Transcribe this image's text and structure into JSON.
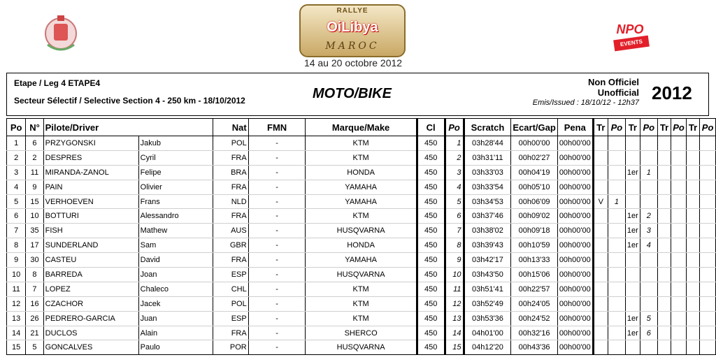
{
  "event": {
    "logo_top_text": "RALLYE",
    "logo_brand": "OiLibya",
    "logo_bottom_text": "MAROC",
    "dates": "14 au 20 octobre 2012",
    "organizer_logo": "NPO",
    "organizer_logo_sub": "EVENTS"
  },
  "header": {
    "etape": "Etape / Leg 4  ETAPE4",
    "secteur": "Secteur Sélectif / Selective Section 4 - 250 km - 18/10/2012",
    "category": "MOTO/BIKE",
    "status_fr": "Non Officiel",
    "status_en": "Unofficial",
    "emis": "Emis/Issued : 18/10/12 - 12h37",
    "year": "2012"
  },
  "columns": [
    "Po",
    "N°",
    "Pilote/Driver",
    "Nat",
    "FMN",
    "Marque/Make",
    "Cl",
    "Po",
    "Scratch",
    "Ecart/Gap",
    "Pena",
    "Tr",
    "Po",
    "Tr",
    "Po",
    "Tr",
    "Po",
    "Tr",
    "Po"
  ],
  "rows": [
    {
      "po": "1",
      "num": "6",
      "last": "PRZYGONSKI",
      "first": "Jakub",
      "nat": "POL",
      "fmn": "-",
      "make": "KTM",
      "cl": "450",
      "cpo": "1",
      "scratch": "03h28'44",
      "gap": "00h00'00",
      "pena": "00h00'00",
      "tr1": "",
      "po1": "",
      "tr2": "",
      "po2": "",
      "tr3": "",
      "po3": "",
      "tr4": "",
      "po4": ""
    },
    {
      "po": "2",
      "num": "2",
      "last": "DESPRES",
      "first": "Cyril",
      "nat": "FRA",
      "fmn": "-",
      "make": "KTM",
      "cl": "450",
      "cpo": "2",
      "scratch": "03h31'11",
      "gap": "00h02'27",
      "pena": "00h00'00",
      "tr1": "",
      "po1": "",
      "tr2": "",
      "po2": "",
      "tr3": "",
      "po3": "",
      "tr4": "",
      "po4": ""
    },
    {
      "po": "3",
      "num": "11",
      "last": "MIRANDA-ZANOL",
      "first": "Felipe",
      "nat": "BRA",
      "fmn": "-",
      "make": "HONDA",
      "cl": "450",
      "cpo": "3",
      "scratch": "03h33'03",
      "gap": "00h04'19",
      "pena": "00h00'00",
      "tr1": "",
      "po1": "",
      "tr2": "1er",
      "po2": "1",
      "tr3": "",
      "po3": "",
      "tr4": "",
      "po4": ""
    },
    {
      "po": "4",
      "num": "9",
      "last": "PAIN",
      "first": "Olivier",
      "nat": "FRA",
      "fmn": "-",
      "make": "YAMAHA",
      "cl": "450",
      "cpo": "4",
      "scratch": "03h33'54",
      "gap": "00h05'10",
      "pena": "00h00'00",
      "tr1": "",
      "po1": "",
      "tr2": "",
      "po2": "",
      "tr3": "",
      "po3": "",
      "tr4": "",
      "po4": ""
    },
    {
      "po": "5",
      "num": "15",
      "last": "VERHOEVEN",
      "first": "Frans",
      "nat": "NLD",
      "fmn": "-",
      "make": "YAMAHA",
      "cl": "450",
      "cpo": "5",
      "scratch": "03h34'53",
      "gap": "00h06'09",
      "pena": "00h00'00",
      "tr1": "V",
      "po1": "1",
      "tr2": "",
      "po2": "",
      "tr3": "",
      "po3": "",
      "tr4": "",
      "po4": ""
    },
    {
      "po": "6",
      "num": "10",
      "last": "BOTTURI",
      "first": "Alessandro",
      "nat": "FRA",
      "fmn": "-",
      "make": "KTM",
      "cl": "450",
      "cpo": "6",
      "scratch": "03h37'46",
      "gap": "00h09'02",
      "pena": "00h00'00",
      "tr1": "",
      "po1": "",
      "tr2": "1er",
      "po2": "2",
      "tr3": "",
      "po3": "",
      "tr4": "",
      "po4": ""
    },
    {
      "po": "7",
      "num": "35",
      "last": "FISH",
      "first": "Mathew",
      "nat": "AUS",
      "fmn": "-",
      "make": "HUSQVARNA",
      "cl": "450",
      "cpo": "7",
      "scratch": "03h38'02",
      "gap": "00h09'18",
      "pena": "00h00'00",
      "tr1": "",
      "po1": "",
      "tr2": "1er",
      "po2": "3",
      "tr3": "",
      "po3": "",
      "tr4": "",
      "po4": ""
    },
    {
      "po": "8",
      "num": "17",
      "last": "SUNDERLAND",
      "first": "Sam",
      "nat": "GBR",
      "fmn": "-",
      "make": "HONDA",
      "cl": "450",
      "cpo": "8",
      "scratch": "03h39'43",
      "gap": "00h10'59",
      "pena": "00h00'00",
      "tr1": "",
      "po1": "",
      "tr2": "1er",
      "po2": "4",
      "tr3": "",
      "po3": "",
      "tr4": "",
      "po4": ""
    },
    {
      "po": "9",
      "num": "30",
      "last": "CASTEU",
      "first": "David",
      "nat": "FRA",
      "fmn": "-",
      "make": "YAMAHA",
      "cl": "450",
      "cpo": "9",
      "scratch": "03h42'17",
      "gap": "00h13'33",
      "pena": "00h00'00",
      "tr1": "",
      "po1": "",
      "tr2": "",
      "po2": "",
      "tr3": "",
      "po3": "",
      "tr4": "",
      "po4": ""
    },
    {
      "po": "10",
      "num": "8",
      "last": "BARREDA",
      "first": "Joan",
      "nat": "ESP",
      "fmn": "-",
      "make": "HUSQVARNA",
      "cl": "450",
      "cpo": "10",
      "scratch": "03h43'50",
      "gap": "00h15'06",
      "pena": "00h00'00",
      "tr1": "",
      "po1": "",
      "tr2": "",
      "po2": "",
      "tr3": "",
      "po3": "",
      "tr4": "",
      "po4": ""
    },
    {
      "po": "11",
      "num": "7",
      "last": "LOPEZ",
      "first": "Chaleco",
      "nat": "CHL",
      "fmn": "-",
      "make": "KTM",
      "cl": "450",
      "cpo": "11",
      "scratch": "03h51'41",
      "gap": "00h22'57",
      "pena": "00h00'00",
      "tr1": "",
      "po1": "",
      "tr2": "",
      "po2": "",
      "tr3": "",
      "po3": "",
      "tr4": "",
      "po4": ""
    },
    {
      "po": "12",
      "num": "16",
      "last": "CZACHOR",
      "first": "Jacek",
      "nat": "POL",
      "fmn": "-",
      "make": "KTM",
      "cl": "450",
      "cpo": "12",
      "scratch": "03h52'49",
      "gap": "00h24'05",
      "pena": "00h00'00",
      "tr1": "",
      "po1": "",
      "tr2": "",
      "po2": "",
      "tr3": "",
      "po3": "",
      "tr4": "",
      "po4": ""
    },
    {
      "po": "13",
      "num": "26",
      "last": "PEDRERO-GARCIA",
      "first": "Juan",
      "nat": "ESP",
      "fmn": "-",
      "make": "KTM",
      "cl": "450",
      "cpo": "13",
      "scratch": "03h53'36",
      "gap": "00h24'52",
      "pena": "00h00'00",
      "tr1": "",
      "po1": "",
      "tr2": "1er",
      "po2": "5",
      "tr3": "",
      "po3": "",
      "tr4": "",
      "po4": ""
    },
    {
      "po": "14",
      "num": "21",
      "last": "DUCLOS",
      "first": "Alain",
      "nat": "FRA",
      "fmn": "-",
      "make": "SHERCO",
      "cl": "450",
      "cpo": "14",
      "scratch": "04h01'00",
      "gap": "00h32'16",
      "pena": "00h00'00",
      "tr1": "",
      "po1": "",
      "tr2": "1er",
      "po2": "6",
      "tr3": "",
      "po3": "",
      "tr4": "",
      "po4": ""
    },
    {
      "po": "15",
      "num": "5",
      "last": "GONCALVES",
      "first": "Paulo",
      "nat": "POR",
      "fmn": "-",
      "make": "HUSQVARNA",
      "cl": "450",
      "cpo": "15",
      "scratch": "04h12'20",
      "gap": "00h43'36",
      "pena": "00h00'00",
      "tr1": "",
      "po1": "",
      "tr2": "",
      "po2": "",
      "tr3": "",
      "po3": "",
      "tr4": "",
      "po4": ""
    }
  ]
}
